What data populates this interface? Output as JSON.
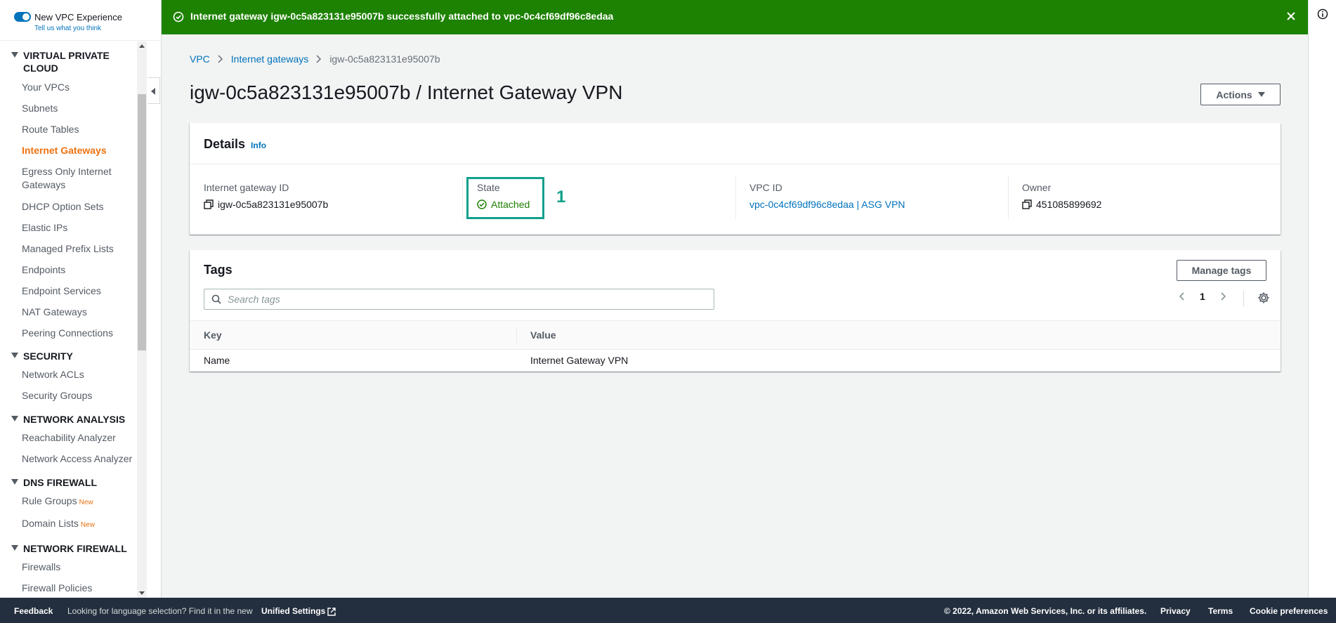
{
  "flash": {
    "message": "Internet gateway igw-0c5a823131e95007b successfully attached to vpc-0c4cf69df96c8edaa",
    "color": "#1d8102"
  },
  "sidebar": {
    "vpc_experience": {
      "title": "New VPC Experience",
      "link": "Tell us what you think"
    },
    "sections": [
      {
        "title": "VIRTUAL PRIVATE CLOUD",
        "items": [
          "Your VPCs",
          "Subnets",
          "Route Tables",
          "Internet Gateways",
          "Egress Only Internet Gateways",
          "DHCP Option Sets",
          "Elastic IPs",
          "Managed Prefix Lists",
          "Endpoints",
          "Endpoint Services",
          "NAT Gateways",
          "Peering Connections"
        ]
      },
      {
        "title": "SECURITY",
        "items": [
          "Network ACLs",
          "Security Groups"
        ]
      },
      {
        "title": "NETWORK ANALYSIS",
        "items": [
          "Reachability Analyzer",
          "Network Access Analyzer"
        ]
      },
      {
        "title": "DNS FIREWALL",
        "items": [
          "Rule Groups",
          "Domain Lists"
        ]
      },
      {
        "title": "NETWORK FIREWALL",
        "items": [
          "Firewalls",
          "Firewall Policies"
        ]
      }
    ],
    "active_item": "Internet Gateways",
    "new_badge": "New",
    "accent_color": "#ec7211"
  },
  "breadcrumb": {
    "items": [
      "VPC",
      "Internet gateways"
    ],
    "current": "igw-0c5a823131e95007b"
  },
  "page_title": "igw-0c5a823131e95007b / Internet Gateway VPN",
  "actions_label": "Actions",
  "details": {
    "title": "Details",
    "info_label": "Info",
    "igw_label": "Internet gateway ID",
    "igw_value": "igw-0c5a823131e95007b",
    "state_label": "State",
    "state_value": "Attached",
    "vpc_label": "VPC ID",
    "vpc_value": "vpc-0c4cf69df96c8edaa | ASG VPN",
    "owner_label": "Owner",
    "owner_value": "451085899692",
    "annotation": "1"
  },
  "tags": {
    "title": "Tags",
    "manage_label": "Manage tags",
    "search_placeholder": "Search tags",
    "page": "1",
    "columns": [
      "Key",
      "Value"
    ],
    "rows": [
      {
        "key": "Name",
        "value": "Internet Gateway VPN"
      }
    ]
  },
  "footer": {
    "feedback": "Feedback",
    "language_text": "Looking for language selection? Find it in the new",
    "unified_settings": "Unified Settings",
    "copyright": "© 2022, Amazon Web Services, Inc. or its affiliates.",
    "privacy": "Privacy",
    "terms": "Terms",
    "cookies": "Cookie preferences"
  }
}
